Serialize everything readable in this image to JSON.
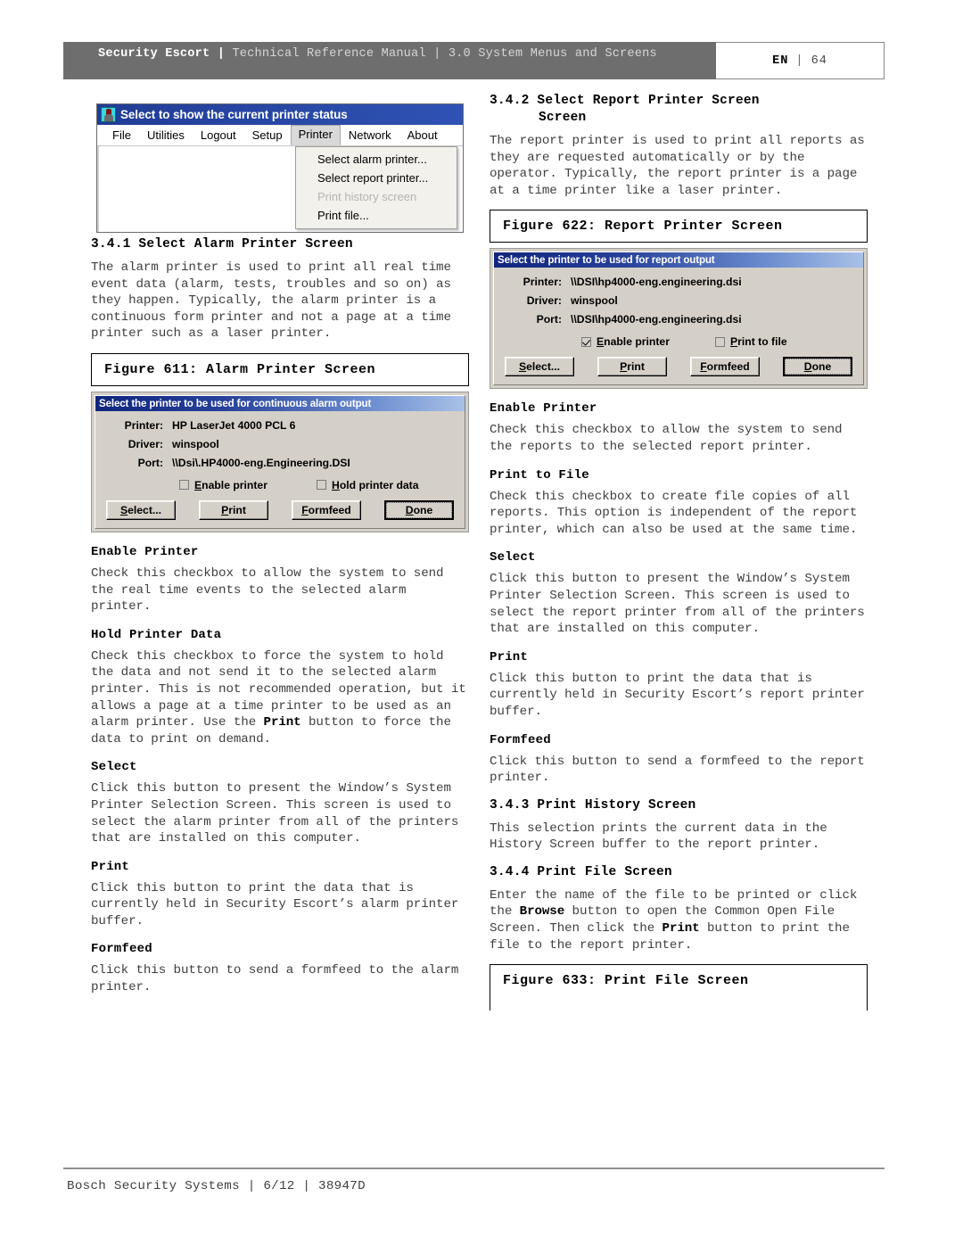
{
  "header": {
    "brand": "Security Escort",
    "sep": "|",
    "subtitle": "Technical Reference Manual | 3.0  System Menus and Screens",
    "lang": "EN",
    "pipe": "|",
    "page_number": "64"
  },
  "app_window": {
    "icon": "printer-status-icon",
    "title": "Select to show the current printer status",
    "menubar": [
      {
        "label": "File",
        "open": false
      },
      {
        "label": "Utilities",
        "open": false
      },
      {
        "label": "Logout",
        "open": false
      },
      {
        "label": "Setup",
        "open": false
      },
      {
        "label": "Printer",
        "open": true
      },
      {
        "label": "Network",
        "open": false
      },
      {
        "label": "About",
        "open": false
      }
    ],
    "dropdown": [
      {
        "label": "Select alarm printer...",
        "disabled": false
      },
      {
        "label": "Select report printer...",
        "disabled": false
      },
      {
        "label": "Print history screen",
        "disabled": true
      },
      {
        "label": "Print file...",
        "disabled": false
      }
    ]
  },
  "left_column": {
    "section_number": "3.4.1",
    "section_title": "Select Alarm Printer Screen",
    "intro": "The alarm printer is used to print all real time event data (alarm, tests, troubles and so on) as they happen. Typically, the alarm printer is a continuous form printer and not a page at a time printer such as a laser printer.",
    "figure_caption": "Figure 611: Alarm Printer Screen",
    "dialog": {
      "caption": "Select the printer to be used for continuous alarm output",
      "fields": [
        {
          "label": "Printer:",
          "value": "HP LaserJet 4000 PCL 6"
        },
        {
          "label": "Driver:",
          "value": "winspool"
        },
        {
          "label": "Port:",
          "value": "\\\\Dsi\\.HP4000-eng.Engineering.DSI"
        }
      ],
      "checkboxes": [
        {
          "accel": "E",
          "rest": "nable printer",
          "checked": false
        },
        {
          "accel": "H",
          "rest": "old printer data",
          "checked": false
        }
      ],
      "buttons": [
        {
          "accel": "S",
          "rest": "elect...",
          "default": false
        },
        {
          "accel": "P",
          "rest": "rint",
          "default": false
        },
        {
          "accel": "F",
          "rest": "ormfeed",
          "default": false
        },
        {
          "accel": "D",
          "rest": "one",
          "default": true
        }
      ]
    },
    "topics": [
      {
        "heading": "Enable Printer",
        "body": "Check this checkbox to allow the system to send the real time events to the selected alarm printer."
      },
      {
        "heading": "Hold Printer Data",
        "body_pre": "Check this checkbox to force the system to hold the data and not send it to the selected alarm printer. This is not recommended operation, but it allows a page at a time printer to be used as an alarm printer. Use the ",
        "body_bold": "Print",
        "body_post": " button to force the data to print on demand."
      },
      {
        "heading": "Select",
        "body": "Click this button to present the Window’s System Printer Selection Screen. This screen is used to select the alarm printer from all of the printers that are installed on this computer."
      },
      {
        "heading": "Print",
        "body": "Click this button to print the data that is currently held in Security Escort’s alarm printer buffer."
      },
      {
        "heading": "Formfeed",
        "body": "Click this button to send a formfeed to the alarm printer."
      }
    ]
  },
  "right_column": {
    "section_number": "3.4.2",
    "section_title": "Select Report Printer Screen",
    "section_title_cont": "Screen",
    "intro": "The report printer is used to print all reports as they are requested automatically or by the operator. Typically, the report printer is a page at a time printer like a laser printer.",
    "figure_caption": "Figure 622: Report Printer Screen",
    "dialog": {
      "caption": "Select the printer to be used for report output",
      "fields": [
        {
          "label": "Printer:",
          "value": "\\\\DSI\\hp4000-eng.engineering.dsi"
        },
        {
          "label": "Driver:",
          "value": "winspool"
        },
        {
          "label": "Port:",
          "value": "\\\\DSI\\hp4000-eng.engineering.dsi"
        }
      ],
      "checkboxes": [
        {
          "accel": "E",
          "rest": "nable printer",
          "checked": true
        },
        {
          "accel": "P",
          "rest": "rint to file",
          "checked": false
        }
      ],
      "buttons": [
        {
          "accel": "S",
          "rest": "elect...",
          "default": false
        },
        {
          "accel": "P",
          "rest": "rint",
          "default": false
        },
        {
          "accel": "F",
          "rest": "ormfeed",
          "default": false
        },
        {
          "accel": "D",
          "rest": "one",
          "default": true
        }
      ]
    },
    "topics": [
      {
        "heading": "Enable Printer",
        "body": "Check this checkbox to allow the system to send the reports to the selected report printer."
      },
      {
        "heading": "Print to File",
        "body": "Check this checkbox to create file copies of all reports. This option is independent of the report printer, which can also be used at the same time."
      },
      {
        "heading": "Select",
        "body": "Click this button to present the Window’s System Printer Selection Screen. This screen is used to select the report printer from all of the printers that are installed on this computer."
      },
      {
        "heading": "Print",
        "body": "Click this button to print the data that is currently held in Security Escort’s report printer buffer."
      },
      {
        "heading": "Formfeed",
        "body": "Click this button to send a formfeed to the report printer."
      }
    ],
    "section2": {
      "number": "3.4.3",
      "title": "Print History Screen",
      "body": "This selection prints the current data in the History Screen buffer to the report printer."
    },
    "section3": {
      "number": "3.4.4",
      "title": "Print File Screen",
      "body_1": "Enter the name of the file to be printed or click the ",
      "body_bold_1": "Browse",
      "body_2": " button to open the Common Open File Screen. Then click the ",
      "body_bold_2": "Print",
      "body_3": " button to print the file to the report printer."
    },
    "figure_caption_2": "Figure 633: Print File Screen"
  },
  "footer": {
    "text": "Bosch Security Systems | 6/12 | 38947D"
  }
}
